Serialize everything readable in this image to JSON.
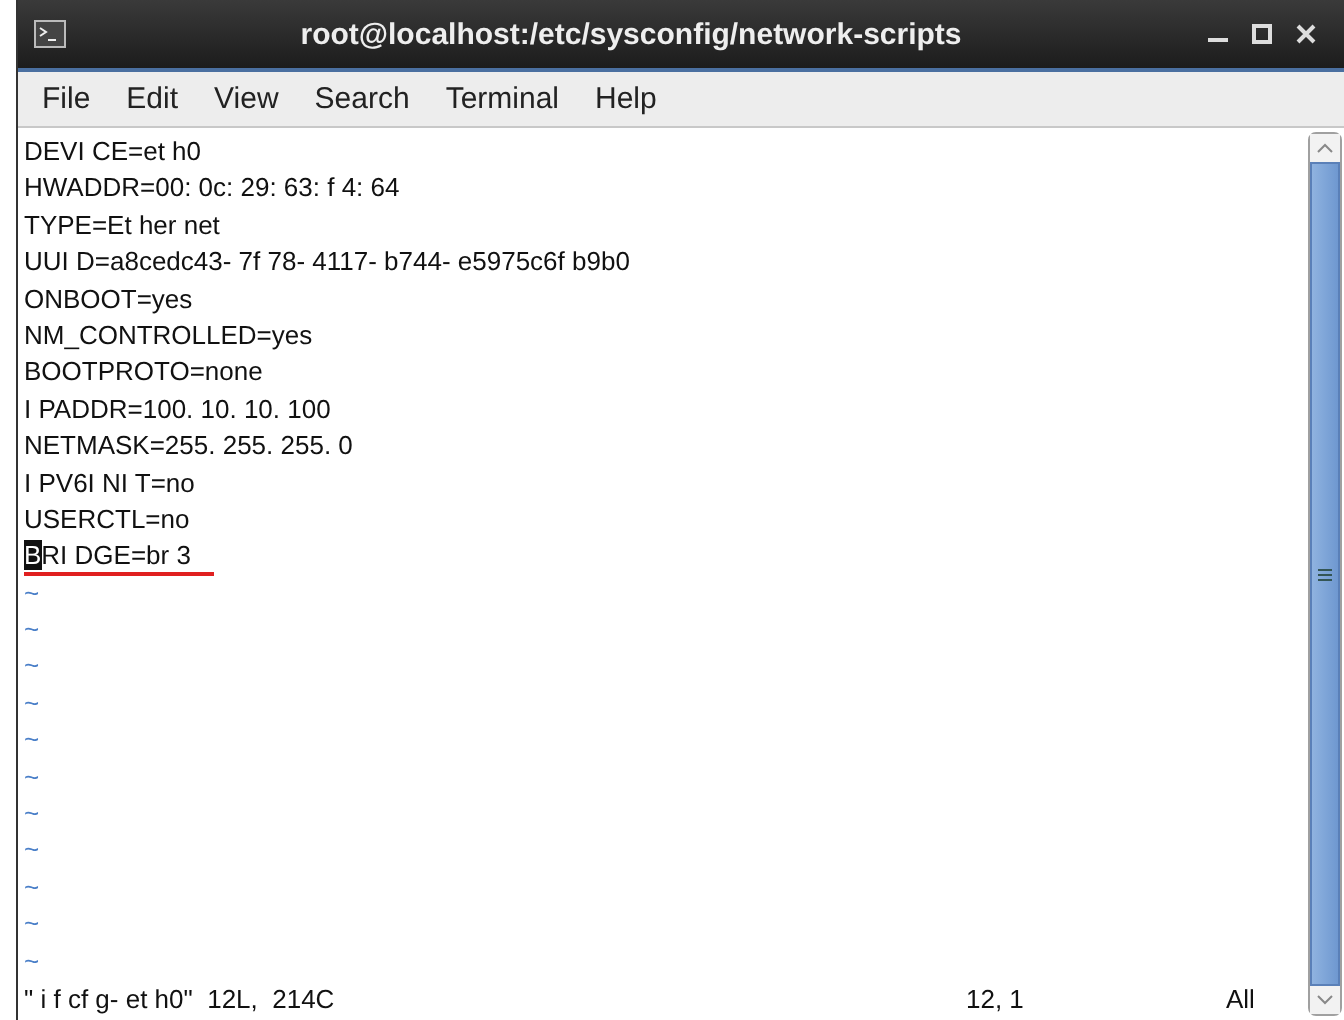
{
  "window": {
    "title": "root@localhost:/etc/sysconfig/network-scripts"
  },
  "menu": [
    "File",
    "Edit",
    "View",
    "Search",
    "Terminal",
    "Help"
  ],
  "lines": [
    {
      "text": "DEVI CE=et h0",
      "cursor": false,
      "underlined": false
    },
    {
      "text": "HWADDR=00: 0c: 29: 63: f 4: 64",
      "cursor": false,
      "underlined": false
    },
    {
      "text": "TYPE=Et her net",
      "cursor": false,
      "underlined": false
    },
    {
      "text": "UUI D=a8cedc43- 7f 78- 4117- b744- e5975c6f b9b0",
      "cursor": false,
      "underlined": false
    },
    {
      "text": "ONBOOT=yes",
      "cursor": false,
      "underlined": false
    },
    {
      "text": "NM_CONTROLLED=yes",
      "cursor": false,
      "underlined": false
    },
    {
      "text": "BOOTPROTO=none",
      "cursor": false,
      "underlined": false
    },
    {
      "text": "I PADDR=100. 10. 10. 100",
      "cursor": false,
      "underlined": false
    },
    {
      "text": "NETMASK=255. 255. 255. 0",
      "cursor": false,
      "underlined": false
    },
    {
      "text": "I PV6I NI T=no",
      "cursor": false,
      "underlined": false
    },
    {
      "text": "USERCTL=no",
      "cursor": false,
      "underlined": false
    },
    {
      "text": "BRI DGE=br 3",
      "cursor": true,
      "underlined": true
    }
  ],
  "tildes": [
    "~",
    "~",
    "~",
    "~",
    "~",
    "~",
    "~",
    "~",
    "~",
    "~",
    "~"
  ],
  "status_bar": {
    "message": "\" i f cf g- et h0\"  12L,  214C",
    "position": "12, 1",
    "scroll": "All"
  }
}
